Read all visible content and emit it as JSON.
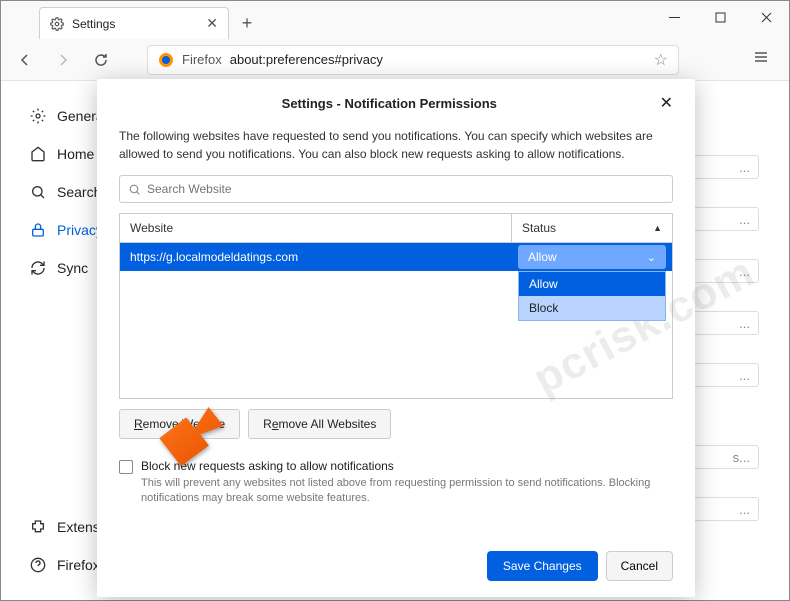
{
  "tab": {
    "title": "Settings"
  },
  "url": {
    "prefix": "Firefox",
    "path": "about:preferences#privacy"
  },
  "sidebar": {
    "items": [
      {
        "label": "General"
      },
      {
        "label": "Home"
      },
      {
        "label": "Search"
      },
      {
        "label": "Privacy & Security"
      },
      {
        "label": "Sync"
      }
    ],
    "bottom": [
      {
        "label": "Extensions & Themes"
      },
      {
        "label": "Firefox Support"
      }
    ]
  },
  "dialog": {
    "title": "Settings - Notification Permissions",
    "intro": "The following websites have requested to send you notifications. You can specify which websites are allowed to send you notifications. You can also block new requests asking to allow notifications.",
    "search_placeholder": "Search Website",
    "headers": {
      "website": "Website",
      "status": "Status"
    },
    "row": {
      "url": "https://g.localmodeldatings.com",
      "status": "Allow"
    },
    "dropdown": {
      "allow": "Allow",
      "block": "Block"
    },
    "remove_website": "Remove Website",
    "remove_all": "Remove All Websites",
    "checkbox_label": "Block new requests asking to allow notifications",
    "checkbox_desc": "This will prevent any websites not listed above from requesting permission to send notifications. Blocking notifications may break some website features.",
    "save": "Save Changes",
    "cancel": "Cancel"
  },
  "watermark": "pcrisk.com",
  "ellipsis": "..."
}
